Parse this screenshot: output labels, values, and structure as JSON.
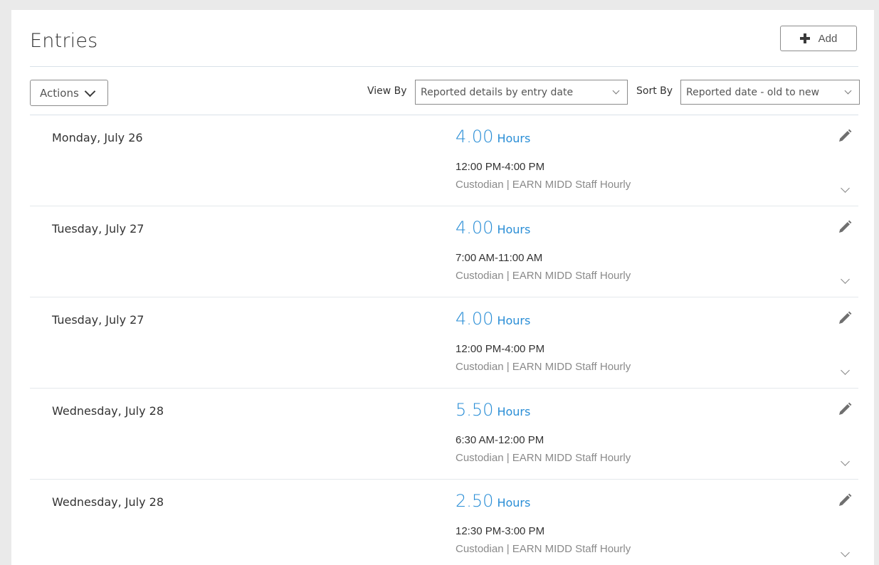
{
  "header": {
    "title": "Entries",
    "add_label": "Add"
  },
  "toolbar": {
    "actions_label": "Actions",
    "view_by_label": "View By",
    "view_by_value": "Reported details by entry date",
    "sort_by_label": "Sort By",
    "sort_by_value": "Reported date - old to new"
  },
  "entries": [
    {
      "date": "Monday, July 26",
      "hours": "4.00",
      "unit": "Hours",
      "time": "12:00 PM-4:00 PM",
      "detail": "Custodian | EARN MIDD Staff Hourly"
    },
    {
      "date": "Tuesday, July 27",
      "hours": "4.00",
      "unit": "Hours",
      "time": "7:00 AM-11:00 AM",
      "detail": "Custodian | EARN MIDD Staff Hourly"
    },
    {
      "date": "Tuesday, July 27",
      "hours": "4.00",
      "unit": "Hours",
      "time": "12:00 PM-4:00 PM",
      "detail": "Custodian | EARN MIDD Staff Hourly"
    },
    {
      "date": "Wednesday, July 28",
      "hours": "5.50",
      "unit": "Hours",
      "time": "6:30 AM-12:00 PM",
      "detail": "Custodian | EARN MIDD Staff Hourly"
    },
    {
      "date": "Wednesday, July 28",
      "hours": "2.50",
      "unit": "Hours",
      "time": "12:30 PM-3:00 PM",
      "detail": "Custodian | EARN MIDD Staff Hourly"
    }
  ],
  "colors": {
    "accent": "#2a8ed6",
    "text": "#333333",
    "muted": "#8a8a8a",
    "border": "#8c8c8c",
    "background": "#eaeaea"
  },
  "icons": {
    "add": "plus-icon",
    "actions": "chevron-down-icon",
    "edit": "pencil-icon",
    "expand": "chevron-down-icon"
  }
}
